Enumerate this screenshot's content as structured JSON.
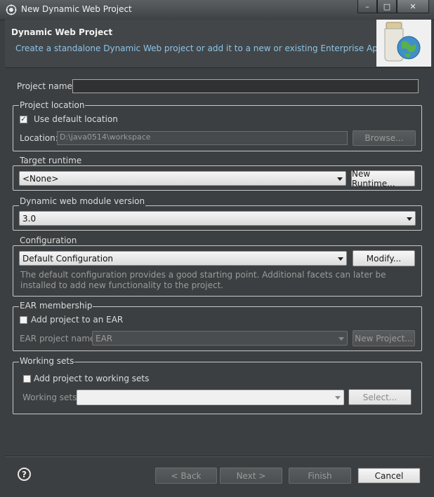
{
  "window": {
    "title": "New Dynamic Web Project",
    "controls": {
      "minimize": "–",
      "maximize": "□",
      "close": "✕"
    }
  },
  "header": {
    "title": "Dynamic Web Project",
    "description": "Create a standalone Dynamic Web project or add it to a new or existing Enterprise Application."
  },
  "project_name": {
    "label": "Project name:",
    "value": ""
  },
  "project_location": {
    "group_title": "Project location",
    "use_default_label": "Use default location",
    "use_default_checked": true,
    "location_label": "Location:",
    "location_value": "D:\\java0514\\workspace",
    "browse_label": "Browse..."
  },
  "target_runtime": {
    "group_title": "Target runtime",
    "selected": "<None>",
    "new_runtime_label": "New Runtime..."
  },
  "module_version": {
    "group_title": "Dynamic web module version",
    "selected": "3.0"
  },
  "configuration": {
    "group_title": "Configuration",
    "selected": "Default Configuration",
    "modify_label": "Modify...",
    "description": "The default configuration provides a good starting point. Additional facets can later be installed to add new functionality to the project."
  },
  "ear": {
    "group_title": "EAR membership",
    "add_label": "Add project to an EAR",
    "add_checked": false,
    "ear_name_label": "EAR project name:",
    "ear_name_value": "EAR",
    "new_project_label": "New Project..."
  },
  "working_sets": {
    "group_title": "Working sets",
    "add_label": "Add project to working sets",
    "add_checked": false,
    "sets_label": "Working sets:",
    "sets_value": "",
    "select_label": "Select..."
  },
  "footer": {
    "help_icon": "help-icon",
    "back_label": "< Back",
    "next_label": "Next >",
    "finish_label": "Finish",
    "cancel_label": "Cancel"
  },
  "colors": {
    "background": "#3c3f41",
    "header_description": "#8cc4e8",
    "title_text": "#f2f2f2"
  }
}
